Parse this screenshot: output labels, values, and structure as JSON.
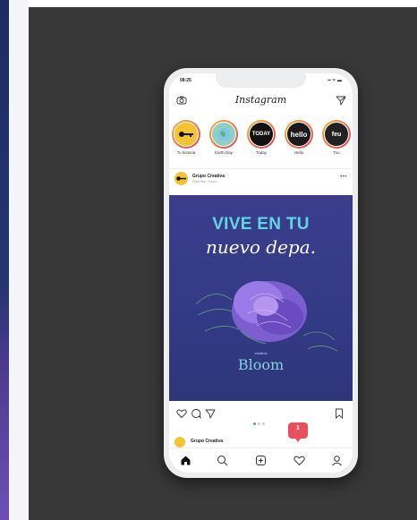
{
  "colors": {
    "background_panel": "#383838",
    "post_background": "#343a86",
    "headline_accent": "#5fd6e4",
    "brand_accent": "#7fd2dd",
    "story_ring": "#f0a040",
    "notification": "#e8505b"
  },
  "status": {
    "time": "08:25",
    "icons": "▪▪ ᯤ ▬"
  },
  "app": {
    "title": "Instagram"
  },
  "stories": [
    {
      "label": "Tu historia",
      "text": "",
      "bg": "#f2c432"
    },
    {
      "label": "Earth Day",
      "text": "",
      "bg": "#8fd0c0"
    },
    {
      "label": "Today",
      "text": "TODAY",
      "bg": "#111111"
    },
    {
      "label": "Hello",
      "text": "hello",
      "bg": "#1a1a1a"
    },
    {
      "label": "Tou",
      "text": "feu",
      "bg": "#222222"
    }
  ],
  "post": {
    "account": "Grupo Creativa",
    "subtitle": "Chorrillo, Surco",
    "headline_1": "VIVE EN TU",
    "headline_2": "nuevo depa.",
    "brand_small": "creativa",
    "brand": "Bloom"
  },
  "notification": {
    "count": "1"
  },
  "next_post": {
    "account": "Grupo Creativa"
  },
  "icons": {
    "camera": "camera-icon",
    "send": "send-icon",
    "like": "heart-icon",
    "comment": "comment-icon",
    "share": "share-icon",
    "save": "bookmark-icon",
    "home": "home-icon",
    "search": "search-icon",
    "add": "add-post-icon",
    "activity": "heart-icon",
    "profile": "profile-icon"
  }
}
